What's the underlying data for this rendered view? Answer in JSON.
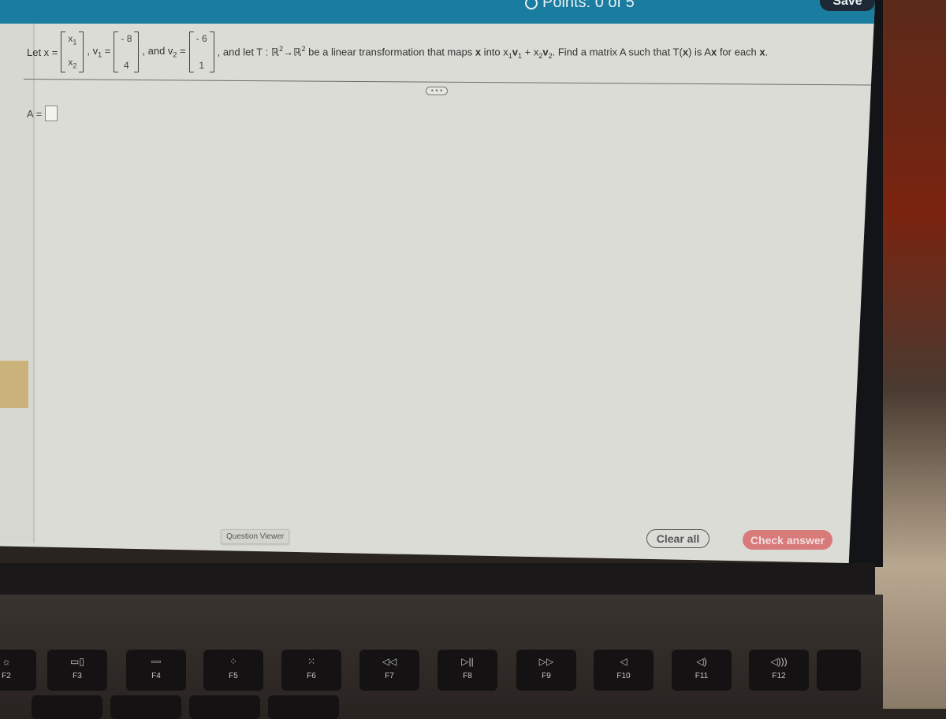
{
  "header": {
    "points_label": "Points: 0 of 5",
    "save_label": "Save"
  },
  "question": {
    "let_x": "Let x =",
    "x_vector": [
      "x1",
      "x2"
    ],
    "x_entries": [
      {
        "base": "x",
        "sub": "1"
      },
      {
        "base": "x",
        "sub": "2"
      }
    ],
    "v1_label": ", v",
    "v1_sub": "1",
    "equals": " =",
    "v1_vector": [
      "- 8",
      "4"
    ],
    "and_v2": ", and v",
    "v2_sub": "2",
    "v2_vector": [
      "- 6",
      "1"
    ],
    "text_part1": ", and let T : ",
    "domain": "ℝ",
    "exp": "2",
    "arrow": "→",
    "codomain": "ℝ",
    "text_part2": " be a linear transformation that maps ",
    "bold_x": "x",
    "text_part3": " into x",
    "s1": "1",
    "v_a": "v",
    "plus": " + x",
    "s2": "2",
    "v_b": "v",
    "text_part4": ". Find a matrix A such that T(",
    "text_part5": ") is A",
    "text_part6": " for each ",
    "end": "."
  },
  "more_button": "• • •",
  "answer": {
    "label": "A =",
    "value": ""
  },
  "footer": {
    "question_viewer": "Question Viewer",
    "clear_all": "Clear all",
    "check_answer": "Check answer"
  },
  "keyboard": {
    "fkeys": [
      {
        "label": "F2",
        "icon": "brightness-up-icon",
        "glyph": "☼"
      },
      {
        "label": "F3",
        "icon": "mission-control-icon",
        "glyph": "▭▯"
      },
      {
        "label": "F4",
        "icon": "launchpad-icon",
        "glyph": "▫▫▫"
      },
      {
        "label": "F5",
        "icon": "keyboard-light-down-icon",
        "glyph": "⁘"
      },
      {
        "label": "F6",
        "icon": "keyboard-light-up-icon",
        "glyph": "⁙"
      },
      {
        "label": "F7",
        "icon": "rewind-icon",
        "glyph": "◁◁"
      },
      {
        "label": "F8",
        "icon": "play-pause-icon",
        "glyph": "▷||"
      },
      {
        "label": "F9",
        "icon": "fast-forward-icon",
        "glyph": "▷▷"
      },
      {
        "label": "F10",
        "icon": "mute-icon",
        "glyph": "◁"
      },
      {
        "label": "F11",
        "icon": "volume-down-icon",
        "glyph": "◁)"
      },
      {
        "label": "F12",
        "icon": "volume-up-icon",
        "glyph": "◁)))"
      }
    ]
  }
}
